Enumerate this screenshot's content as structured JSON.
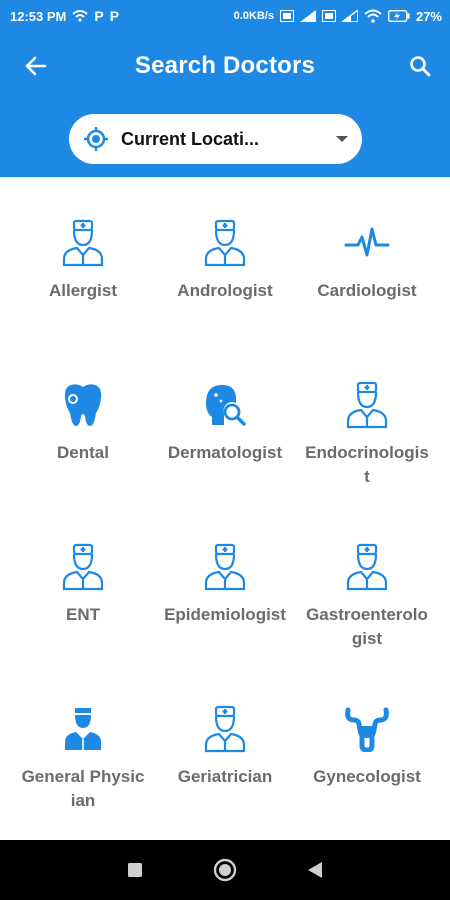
{
  "status_bar": {
    "time": "12:53 PM",
    "left_icons": [
      "wifi-share-icon",
      "p-icon",
      "p-icon"
    ],
    "p_letter": "P",
    "network_speed": "0.0KB/s",
    "battery": "27%",
    "right_icons": [
      "vowifi-icon",
      "signal-icon",
      "vowifi-icon",
      "signal-icon",
      "wifi-icon",
      "battery-charging-icon"
    ]
  },
  "app_bar": {
    "title": "Search Doctors",
    "back_icon": "arrow-left-icon",
    "search_icon": "search-icon",
    "location": {
      "label": "Current Locati...",
      "icon": "my-location-icon",
      "dropdown_icon": "caret-down-icon"
    }
  },
  "specialties": [
    {
      "label": "Allergist",
      "icon": "doctor-icon"
    },
    {
      "label": "Andrologist",
      "icon": "doctor-icon"
    },
    {
      "label": "Cardiologist",
      "icon": "heartbeat-icon"
    },
    {
      "label": "Dental",
      "icon": "tooth-icon"
    },
    {
      "label": "Dermatologist",
      "icon": "skin-search-icon"
    },
    {
      "label": "Endocrinologist",
      "icon": "doctor-icon"
    },
    {
      "label": "ENT",
      "icon": "doctor-icon"
    },
    {
      "label": "Epidemiologist",
      "icon": "doctor-icon"
    },
    {
      "label": "Gastroenterologist",
      "icon": "doctor-icon"
    },
    {
      "label": "General Physician",
      "icon": "physician-icon"
    },
    {
      "label": "Geriatrician",
      "icon": "doctor-icon"
    },
    {
      "label": "Gynecologist",
      "icon": "uterus-icon"
    }
  ],
  "nav_bar": {
    "recents_icon": "square-icon",
    "home_icon": "circle-icon",
    "back_icon": "triangle-back-icon"
  },
  "colors": {
    "primary": "#1e88e5",
    "label_gray": "#6b6b6b",
    "nav_black": "#000000"
  }
}
